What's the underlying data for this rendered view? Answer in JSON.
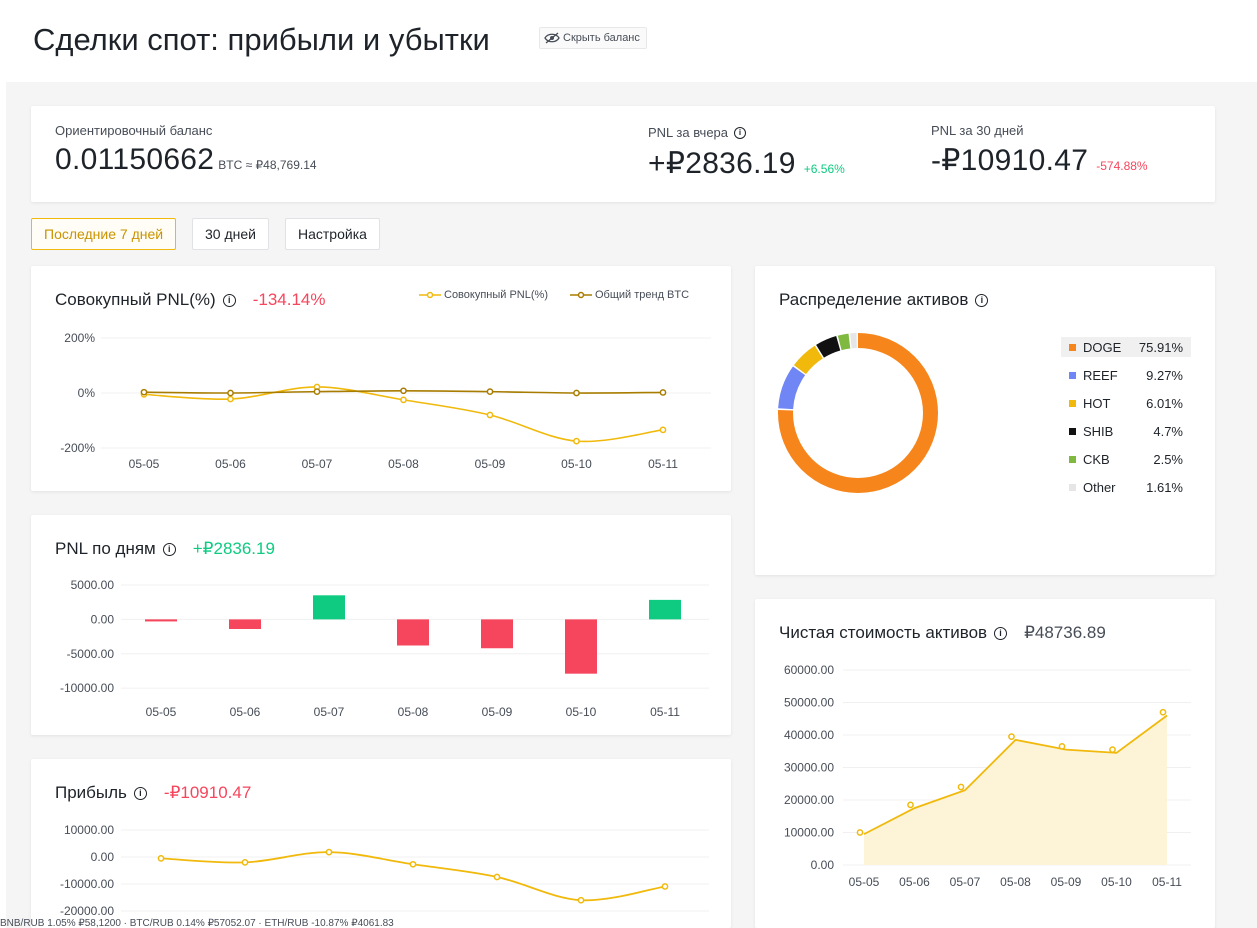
{
  "header": {
    "title": "Сделки спот: прибыли и убытки",
    "hide_balance": "Скрыть баланс"
  },
  "summary": {
    "balance_label": "Ориентировочный баланс",
    "balance_value": "0.01150662",
    "balance_unit": "BTC ≈ ₽48,769.14",
    "yesterday_label": "PNL за вчера",
    "yesterday_value": "+₽2836.19",
    "yesterday_pct": "+6.56%",
    "month_label": "PNL за 30 дней",
    "month_value": "-₽10910.47",
    "month_pct": "-574.88%"
  },
  "filters": {
    "last7": "Последние 7 дней",
    "days30": "30 дней",
    "settings": "Настройка"
  },
  "cumulative": {
    "title": "Совокупный PNL(%)",
    "value": "-134.14%",
    "legend_pnl": "Совокупный PNL(%)",
    "legend_btc": "Общий тренд BTC"
  },
  "daily": {
    "title": "PNL по дням",
    "value": "+₽2836.19"
  },
  "profit": {
    "title": "Прибыль",
    "value": "-₽10910.47"
  },
  "allocation": {
    "title": "Распределение активов"
  },
  "networth": {
    "title": "Чистая стоимость активов",
    "value": "₽48736.89"
  },
  "colors": {
    "accent": "#f0b90b",
    "btc_line": "#a87c00",
    "green": "#0ecb81",
    "red": "#f6465d"
  },
  "chart_data": [
    {
      "type": "line",
      "title": "Совокупный PNL(%)",
      "categories": [
        "05-05",
        "05-06",
        "05-07",
        "05-08",
        "05-09",
        "05-10",
        "05-11"
      ],
      "y_ticks": [
        "200%",
        "0%",
        "-200%"
      ],
      "ylim": [
        -200,
        200
      ],
      "series": [
        {
          "name": "Совокупный PNL(%)",
          "values": [
            -5,
            -22,
            22,
            -25,
            -80,
            -175,
            -134
          ],
          "color": "#f0b90b"
        },
        {
          "name": "Общий тренд BTC",
          "values": [
            3,
            0,
            5,
            8,
            5,
            0,
            2
          ],
          "color": "#a87c00"
        }
      ]
    },
    {
      "type": "bar",
      "title": "PNL по дням",
      "categories": [
        "05-05",
        "05-06",
        "05-07",
        "05-08",
        "05-09",
        "05-10",
        "05-11"
      ],
      "y_ticks": [
        "5000.00",
        "0.00",
        "-5000.00",
        "-10000.00"
      ],
      "ylim": [
        -11000,
        5000
      ],
      "values": [
        -300,
        -1400,
        3500,
        -3800,
        -4200,
        -7900,
        2836.19
      ]
    },
    {
      "type": "line",
      "title": "Прибыль",
      "categories": [
        "05-05",
        "05-06",
        "05-07",
        "05-08",
        "05-09",
        "05-10",
        "05-11"
      ],
      "y_ticks": [
        "10000.00",
        "0.00",
        "-10000.00",
        "-20000.00"
      ],
      "ylim": [
        -20000,
        10000
      ],
      "values": [
        -500,
        -2000,
        1800,
        -2700,
        -7400,
        -16000,
        -10910.47
      ]
    },
    {
      "type": "pie",
      "title": "Распределение активов",
      "labels": [
        "DOGE",
        "REEF",
        "HOT",
        "SHIB",
        "CKB",
        "Other"
      ],
      "pct_labels": [
        "75.91%",
        "9.27%",
        "6.01%",
        "4.7%",
        "2.5%",
        "1.61%"
      ],
      "values": [
        75.91,
        9.27,
        6.01,
        4.7,
        2.5,
        1.61
      ],
      "colors": [
        "#f6851b",
        "#6f86f4",
        "#f0b90b",
        "#111111",
        "#7fb93f",
        "#e6e6e6"
      ]
    },
    {
      "type": "area",
      "title": "Чистая стоимость активов",
      "categories": [
        "05-05",
        "05-06",
        "05-07",
        "05-08",
        "05-09",
        "05-10",
        "05-11"
      ],
      "y_ticks": [
        "60000.00",
        "50000.00",
        "40000.00",
        "30000.00",
        "20000.00",
        "10000.00",
        "0.00"
      ],
      "ylim": [
        0,
        60000
      ],
      "values": [
        9500,
        17500,
        23000,
        38500,
        35500,
        34500,
        46000
      ],
      "markers": [
        10000,
        18500,
        24000,
        39500,
        36500,
        35500,
        47000
      ]
    }
  ],
  "ticker": "BNB/RUB  1.05%  ₽58,1200   ·   BTC/RUB  0.14%  ₽57052.07   ·   ETH/RUB  -10.87%  ₽4061.83"
}
